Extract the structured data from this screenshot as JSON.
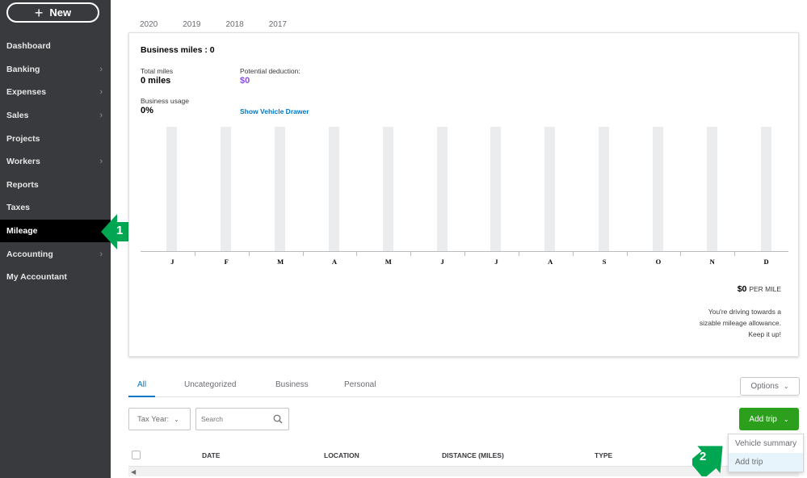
{
  "sidebar": {
    "new_label": "New",
    "items": [
      {
        "label": "Dashboard",
        "chevron": false,
        "active": false
      },
      {
        "label": "Banking",
        "chevron": true,
        "active": false
      },
      {
        "label": "Expenses",
        "chevron": true,
        "active": false
      },
      {
        "label": "Sales",
        "chevron": true,
        "active": false
      },
      {
        "label": "Projects",
        "chevron": false,
        "active": false
      },
      {
        "label": "Workers",
        "chevron": true,
        "active": false
      },
      {
        "label": "Reports",
        "chevron": false,
        "active": false
      },
      {
        "label": "Taxes",
        "chevron": false,
        "active": false
      },
      {
        "label": "Mileage",
        "chevron": false,
        "active": true
      },
      {
        "label": "Accounting",
        "chevron": true,
        "active": false
      },
      {
        "label": "My Accountant",
        "chevron": false,
        "active": false
      }
    ]
  },
  "callouts": {
    "first": "1",
    "second": "2",
    "color": "#00a651"
  },
  "years": [
    "2020",
    "2019",
    "2018",
    "2017"
  ],
  "summary": {
    "title": "Business  miles : 0",
    "total_miles_label": "Total  miles",
    "total_miles_value": "0 miles",
    "deduction_label": "Potential deduction:",
    "deduction_value": "$0",
    "usage_label": "Business usage",
    "usage_value": "0%",
    "vehicle_link": "Show Vehicle Drawer"
  },
  "chart_data": {
    "type": "bar",
    "categories": [
      "J",
      "F",
      "M",
      "A",
      "M",
      "J",
      "J",
      "A",
      "S",
      "O",
      "N",
      "D"
    ],
    "values": [
      0,
      0,
      0,
      0,
      0,
      0,
      0,
      0,
      0,
      0,
      0,
      0
    ],
    "bar_color": "#ebecee"
  },
  "rate": {
    "value": "$0",
    "unit": "PER MILE"
  },
  "encouragement": [
    "You're driving towards a",
    "sizable mileage allowance.",
    "Keep it up!"
  ],
  "filter_tabs": [
    {
      "label": "All",
      "active": true
    },
    {
      "label": "Uncategorized",
      "active": false
    },
    {
      "label": "Business",
      "active": false
    },
    {
      "label": "Personal",
      "active": false
    }
  ],
  "options_label": "Options",
  "tax_year_label": "Tax Year:",
  "search_placeholder": "Search",
  "add_trip_label": "Add trip",
  "add_trip_color": "#2ca01c",
  "dropdown": [
    {
      "label": "Vehicle summary",
      "highlighted": false
    },
    {
      "label": "Add trip",
      "highlighted": true
    }
  ],
  "table": {
    "columns": [
      "DATE",
      "LOCATION",
      "DISTANCE (MILES)",
      "TYPE"
    ]
  }
}
